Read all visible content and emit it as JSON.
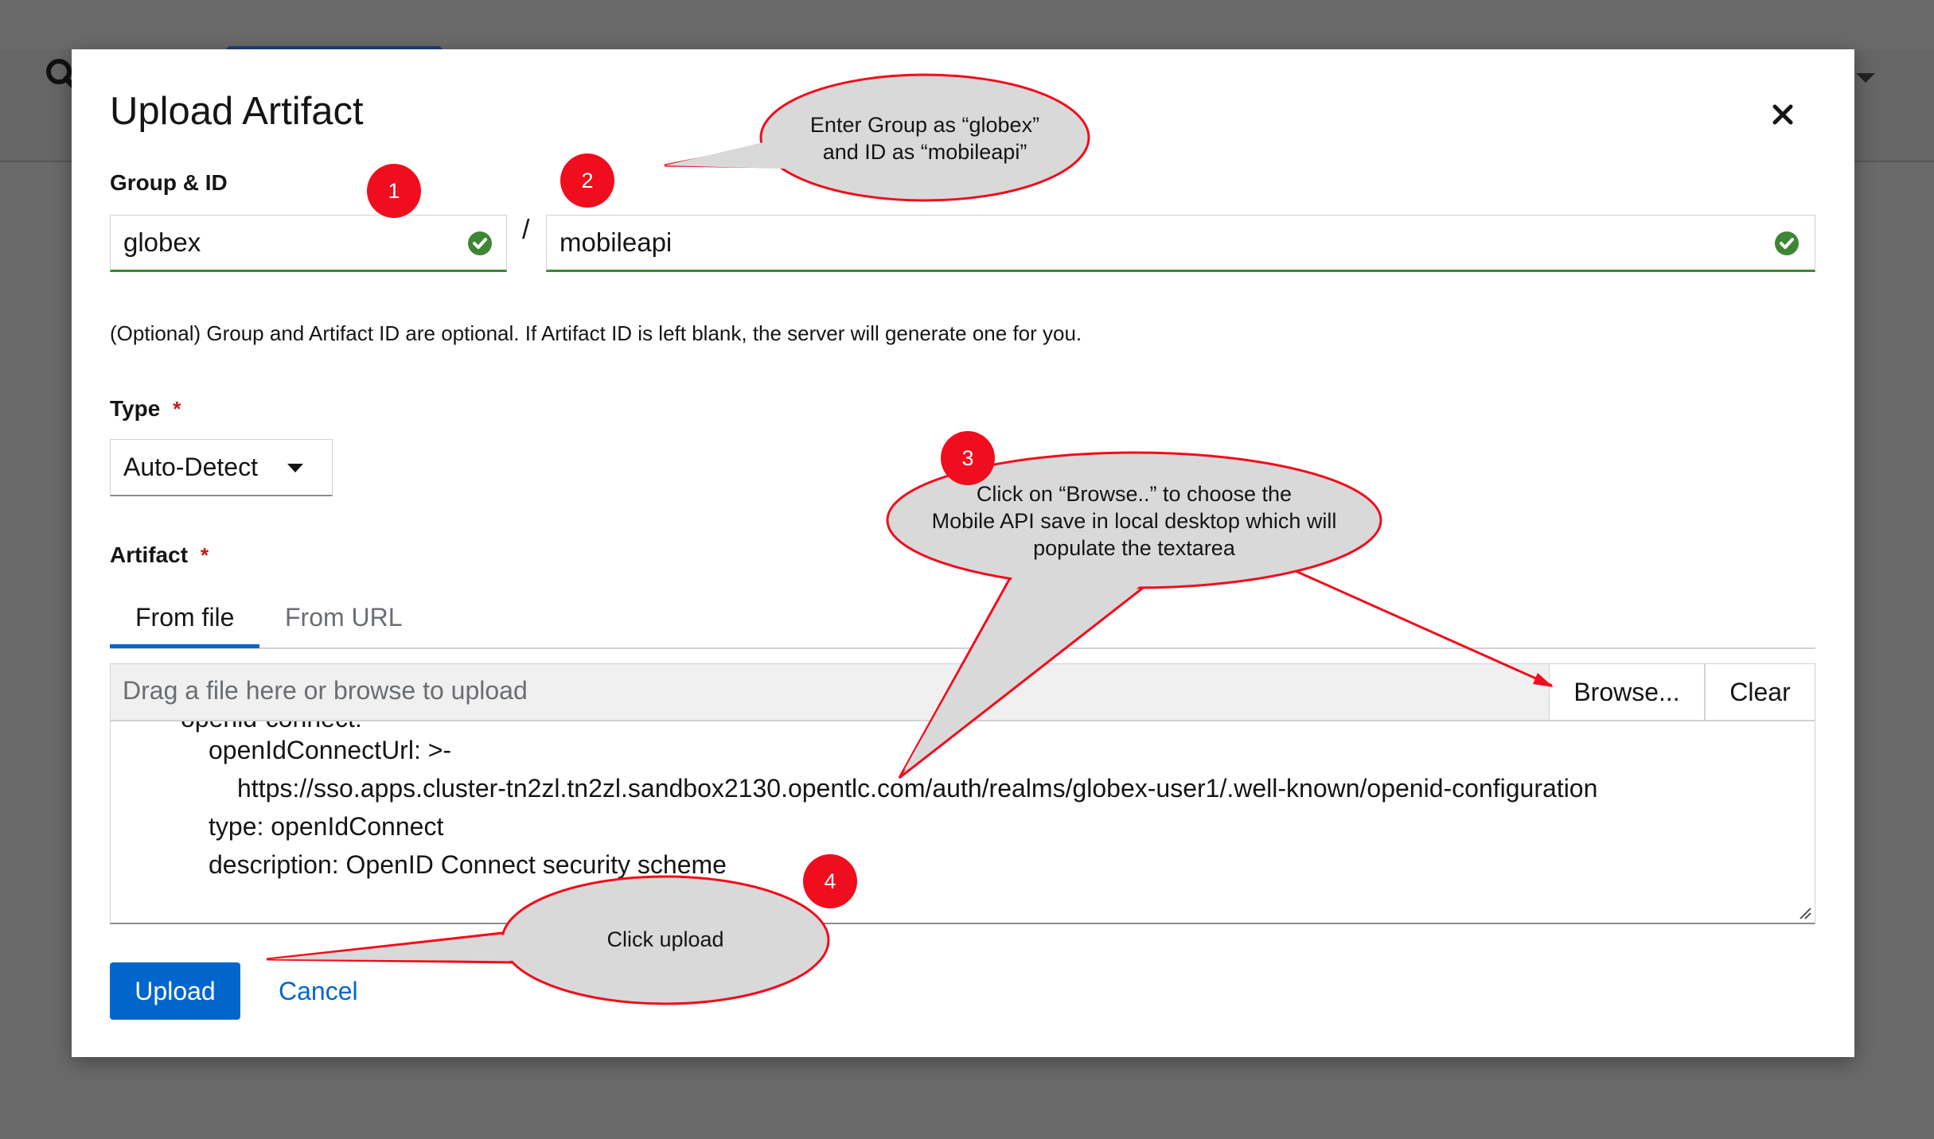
{
  "modal": {
    "title": "Upload Artifact",
    "close_icon": "close-icon"
  },
  "group_id": {
    "label": "Group & ID",
    "group_value": "globex",
    "separator": "/",
    "id_value": "mobileapi",
    "helper_text": "(Optional) Group and Artifact ID are optional. If Artifact ID is left blank, the server will generate one for you."
  },
  "type": {
    "label": "Type",
    "required_mark": "*",
    "selected": "Auto-Detect"
  },
  "artifact": {
    "label": "Artifact",
    "required_mark": "*",
    "tabs": [
      {
        "label": "From file",
        "active": true
      },
      {
        "label": "From URL",
        "active": false
      }
    ],
    "file_placeholder": "Drag a file here or browse to upload",
    "browse_label": "Browse...",
    "clear_label": "Clear",
    "content_lines": [
      "openid-connect:",
      "openIdConnectUrl: >-",
      "https://sso.apps.cluster-tn2zl.tn2zl.sandbox2130.opentlc.com/auth/realms/globex-user1/.well-known/openid-configuration",
      "type: openIdConnect",
      "description: OpenID Connect security scheme"
    ]
  },
  "footer": {
    "upload_label": "Upload",
    "cancel_label": "Cancel"
  },
  "annotations": {
    "callout_1": {
      "badge": "1"
    },
    "callout_2": {
      "badge": "2",
      "line1": "Enter Group as “globex”",
      "line2": "and ID as “mobileapi”"
    },
    "callout_3": {
      "badge": "3",
      "line1": "Click on “Browse..” to choose the",
      "line2": "Mobile API save in local desktop which will",
      "line3": "populate the textarea"
    },
    "callout_4": {
      "badge": "4",
      "text": "Click upload"
    }
  },
  "colors": {
    "primary": "#0066cc",
    "success": "#3e8635",
    "required": "#c9190b",
    "annotation_red": "#f00d1d",
    "callout_fill": "#d9d9d9"
  }
}
